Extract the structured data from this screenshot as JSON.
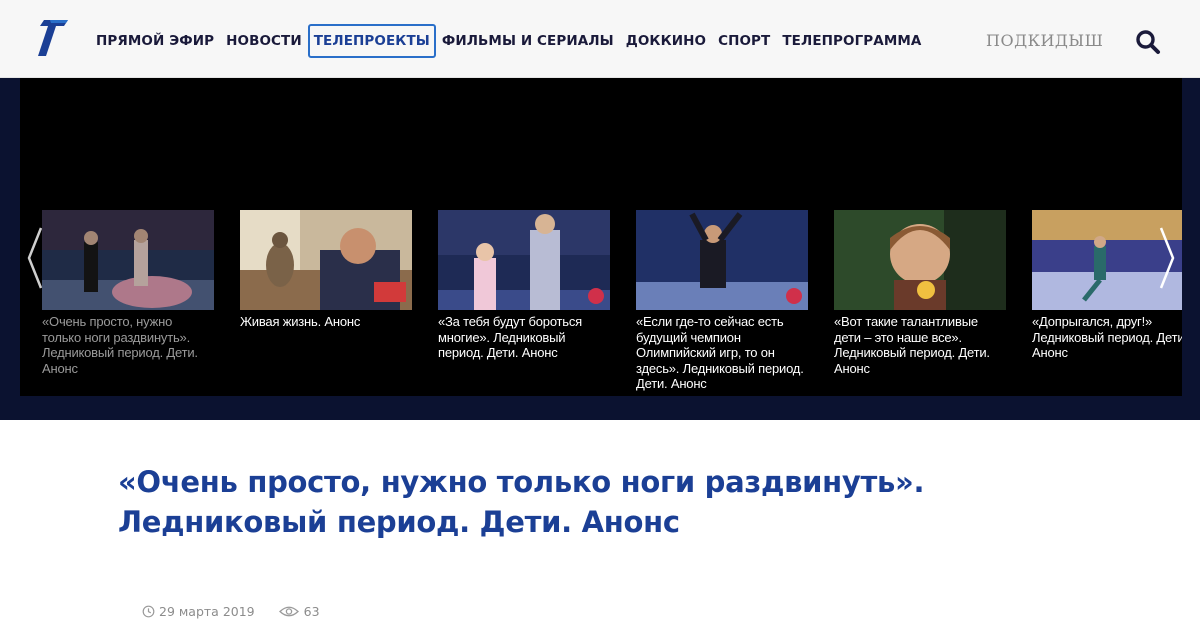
{
  "header": {
    "logo_icon": "channel-one-logo-icon",
    "brand_color": "#1b3f95",
    "nav": [
      {
        "label": "ПРЯМОЙ ЭФИР",
        "active": false
      },
      {
        "label": "НОВОСТИ",
        "active": false
      },
      {
        "label": "ТЕЛЕПРОЕКТЫ",
        "active": true
      },
      {
        "label": "ФИЛЬМЫ И СЕРИАЛЫ",
        "active": false
      },
      {
        "label": "ДОККИНО",
        "active": false
      },
      {
        "label": "СПОРТ",
        "active": false
      },
      {
        "label": "ТЕЛЕПРОГРАММА",
        "active": false
      }
    ],
    "extra_label": "ПОДКИДЫШ",
    "search_icon": "search-icon"
  },
  "carousel": {
    "prev_icon": "chevron-left-icon",
    "next_icon": "chevron-right-icon",
    "items": [
      {
        "caption": "«Очень просто, нужно только ноги раздвинуть». Ледниковый период. Дети. Анонс",
        "current": true
      },
      {
        "caption": "Живая жизнь. Анонс",
        "current": false
      },
      {
        "caption": "«За тебя будут бороться многие». Ледниковый период. Дети. Анонс",
        "current": false
      },
      {
        "caption": "«Если где-то сейчас есть будущий чемпион Олимпийский игр, то он здесь». Ледниковый период. Дети. Анонс",
        "current": false
      },
      {
        "caption": "«Вот такие талантливые дети – это наше все». Ледниковый период. Дети. Анонс",
        "current": false
      },
      {
        "caption": "«Допрыгался, друг!» Ледниковый период. Дети. Анонс",
        "current": false
      }
    ]
  },
  "article": {
    "title": "«Очень просто, нужно только ноги раздвинуть». Ледниковый период. Дети. Анонс",
    "date": "29 марта 2019",
    "views": "63"
  }
}
